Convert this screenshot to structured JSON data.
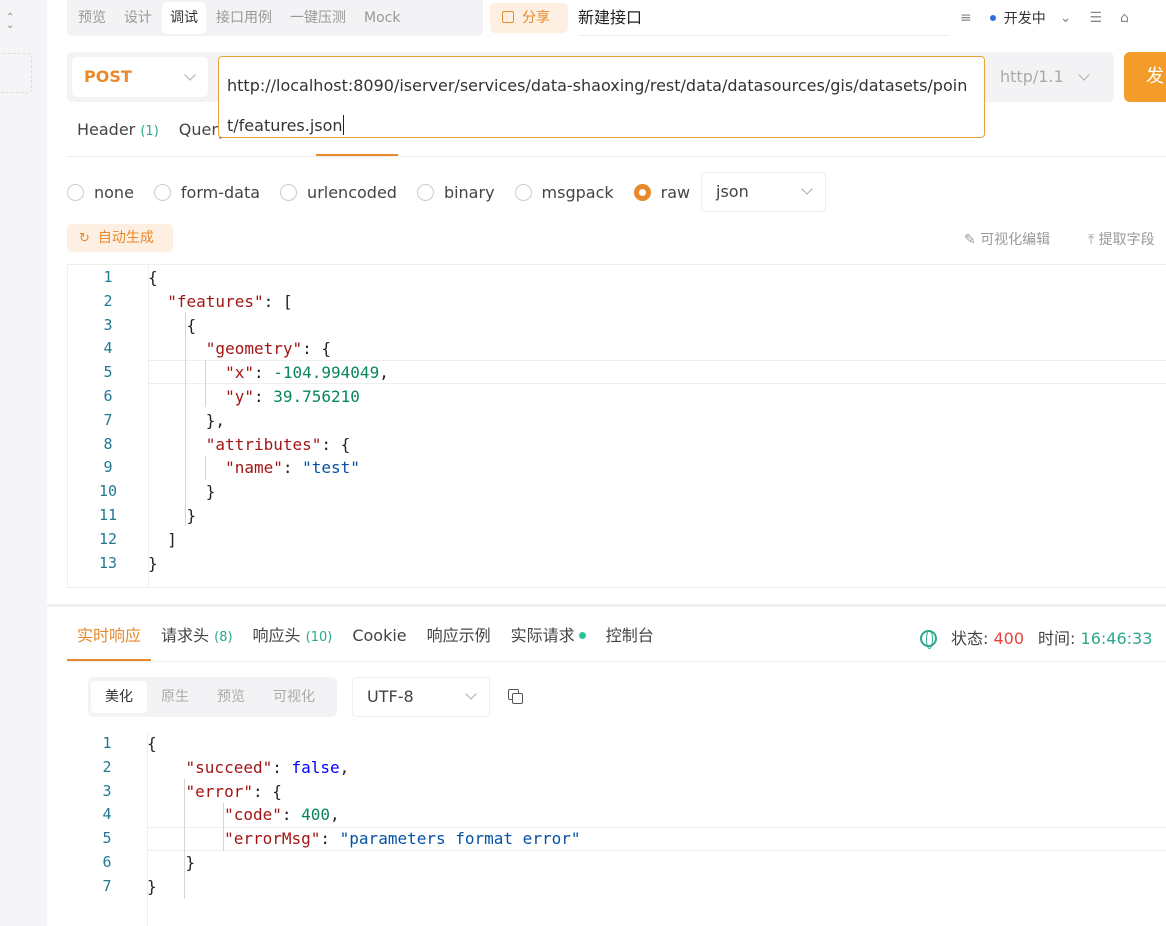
{
  "top_tabs": [
    "预览",
    "设计",
    "调试",
    "接口用例",
    "一键压测",
    "Mock"
  ],
  "active_top_tab": "调试",
  "share_label": "分享",
  "api_name": "新建接口",
  "environment": "开发中",
  "request": {
    "method": "POST",
    "url": "http://localhost:8090/iserver/services/data-shaoxing/rest/data/datasources/gis/datasets/point/features.json",
    "protocol": "http/1.1",
    "send_label": "发"
  },
  "param_tabs": {
    "header": "Header",
    "header_count": "(1)",
    "query": "Query"
  },
  "body_types": [
    "none",
    "form-data",
    "urlencoded",
    "binary",
    "msgpack",
    "raw"
  ],
  "selected_body_type": "raw",
  "body_format": "json",
  "auto_generate": "自动生成",
  "visual_edit": "可视化编辑",
  "extract_fields": "提取字段",
  "request_body_lines": [
    "{",
    "  \"features\": [",
    "    {",
    "      \"geometry\": {",
    "        \"x\": -104.994049,",
    "        \"y\": 39.756210",
    "      },",
    "      \"attributes\": {",
    "        \"name\": \"test\"",
    "      }",
    "    }",
    "  ]",
    "}"
  ],
  "response_tabs": [
    {
      "label": "实时响应",
      "count": ""
    },
    {
      "label": "请求头",
      "count": "(8)"
    },
    {
      "label": "响应头",
      "count": "(10)"
    },
    {
      "label": "Cookie",
      "count": ""
    },
    {
      "label": "响应示例",
      "count": ""
    },
    {
      "label": "实际请求",
      "count": ""
    },
    {
      "label": "控制台",
      "count": ""
    }
  ],
  "status": {
    "label": "状态:",
    "code": "400",
    "time_label": "时间:",
    "time": "16:46:33"
  },
  "view_tabs": [
    "美化",
    "原生",
    "预览",
    "可视化"
  ],
  "encoding": "UTF-8",
  "response_body_lines": [
    "{",
    "    \"succeed\": false,",
    "    \"error\": {",
    "        \"code\": 400,",
    "        \"errorMsg\": \"parameters format error\"",
    "    }",
    "}"
  ]
}
